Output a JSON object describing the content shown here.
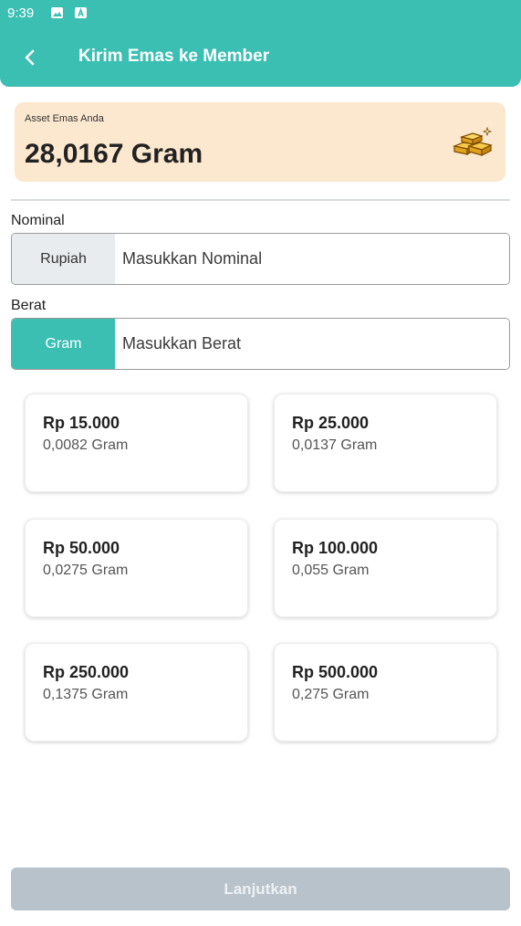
{
  "status_bar": {
    "time": "9:39",
    "icons": [
      "image-icon",
      "font-icon"
    ]
  },
  "header": {
    "title": "Kirim Emas ke Member",
    "back_icon": "chevron-left-icon",
    "color": "#3bbfb3"
  },
  "asset": {
    "label": "Asset Emas Anda",
    "value": "28,0167 Gram",
    "icon": "gold-bars-icon"
  },
  "nominal": {
    "label": "Nominal",
    "prefix": "Rupiah",
    "placeholder": "Masukkan Nominal"
  },
  "berat": {
    "label": "Berat",
    "prefix": "Gram",
    "placeholder": "Masukkan Berat"
  },
  "options": [
    {
      "price": "Rp 15.000",
      "gram": "0,0082 Gram"
    },
    {
      "price": "Rp 25.000",
      "gram": "0,0137 Gram"
    },
    {
      "price": "Rp 50.000",
      "gram": "0,0275 Gram"
    },
    {
      "price": "Rp 100.000",
      "gram": "0,055 Gram"
    },
    {
      "price": "Rp 250.000",
      "gram": "0,1375 Gram"
    },
    {
      "price": "Rp 500.000",
      "gram": "0,275 Gram"
    }
  ],
  "footer": {
    "continue_label": "Lanjutkan"
  }
}
